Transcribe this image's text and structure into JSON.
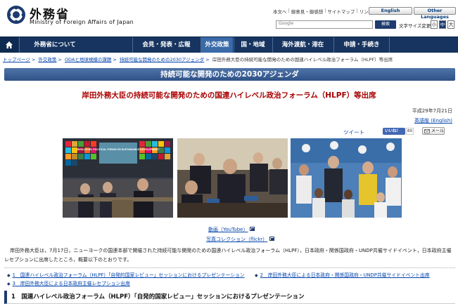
{
  "header": {
    "logo_title": "外務省",
    "logo_sub": "Ministry of Foreign Affairs of Japan",
    "util_links": [
      "本文へ",
      "御意見・御感想",
      "サイトマップ",
      "リンク集"
    ],
    "english_btn": "English",
    "other_btn": "Other Languages",
    "search_placeholder": "Google",
    "search_btn": "検索",
    "fontsize_label": "文字サイズ変更",
    "fontsize_small": "小",
    "fontsize_mid": "中",
    "fontsize_large": "大"
  },
  "nav": {
    "items": [
      "外務省について",
      "会見・発表・広報",
      "外交政策",
      "国・地域",
      "海外渡航・滞在",
      "申請・手続き"
    ],
    "active": "外交政策"
  },
  "breadcrumb": [
    "トップページ",
    "外交政策",
    "ODAと地球規模の課題",
    "持続可能な開発のための2030アジェンダ",
    "岸田外務大臣の持続可能な開発のための国連ハイレベル政治フォーラム（HLPF）等出席"
  ],
  "title_bar": "持続可能な開発のための2030アジェンダ",
  "page_title": "岸田外務大臣の持続可能な開発のための国連ハイレベル政治フォーラム（HLPF）等出席",
  "date": "平成29年7月21日",
  "english_link": "英語版 (English)",
  "social": {
    "tweet": "ツイート",
    "fb_like": "いいね！",
    "fb_count": "60",
    "mail": "メール"
  },
  "photo_caption_1": "HIGH-LEVEL POLITICAL FORUM ON SUSTAINABLE DEVELOPMENT",
  "links": {
    "video": "動画（YouTube）",
    "photo": "写真コレクション（flickr）"
  },
  "body_text": "岸田外務大臣は，7月17日，ニューヨークの国連本部で開催された持続可能な開発のための国連ハイレベル政治フォーラム（HLPF），日本政府・関係国政府・UNDP共催サイドイベント，日本政府主催レセプションに出席したところ，概要以下のとおりです。",
  "toc": [
    "1　国連ハイレベル政治フォーラム（HLPF）「自発的国家レビュー」セッションにおけるプレゼンテーション",
    "2　岸田外務大臣による日本政府・関係国政府・UNDP共催サイドイベント出席",
    "3　岸田外務大臣による日本政府主催レセプション出席"
  ],
  "section_head": "1　国連ハイレベル政治フォーラム（HLPF）「自発的国家レビュー」セッションにおけるプレゼンテーション",
  "colors": {
    "nav_bg": "#16345f",
    "title_red": "#a80000",
    "link_blue": "#0645ad"
  }
}
